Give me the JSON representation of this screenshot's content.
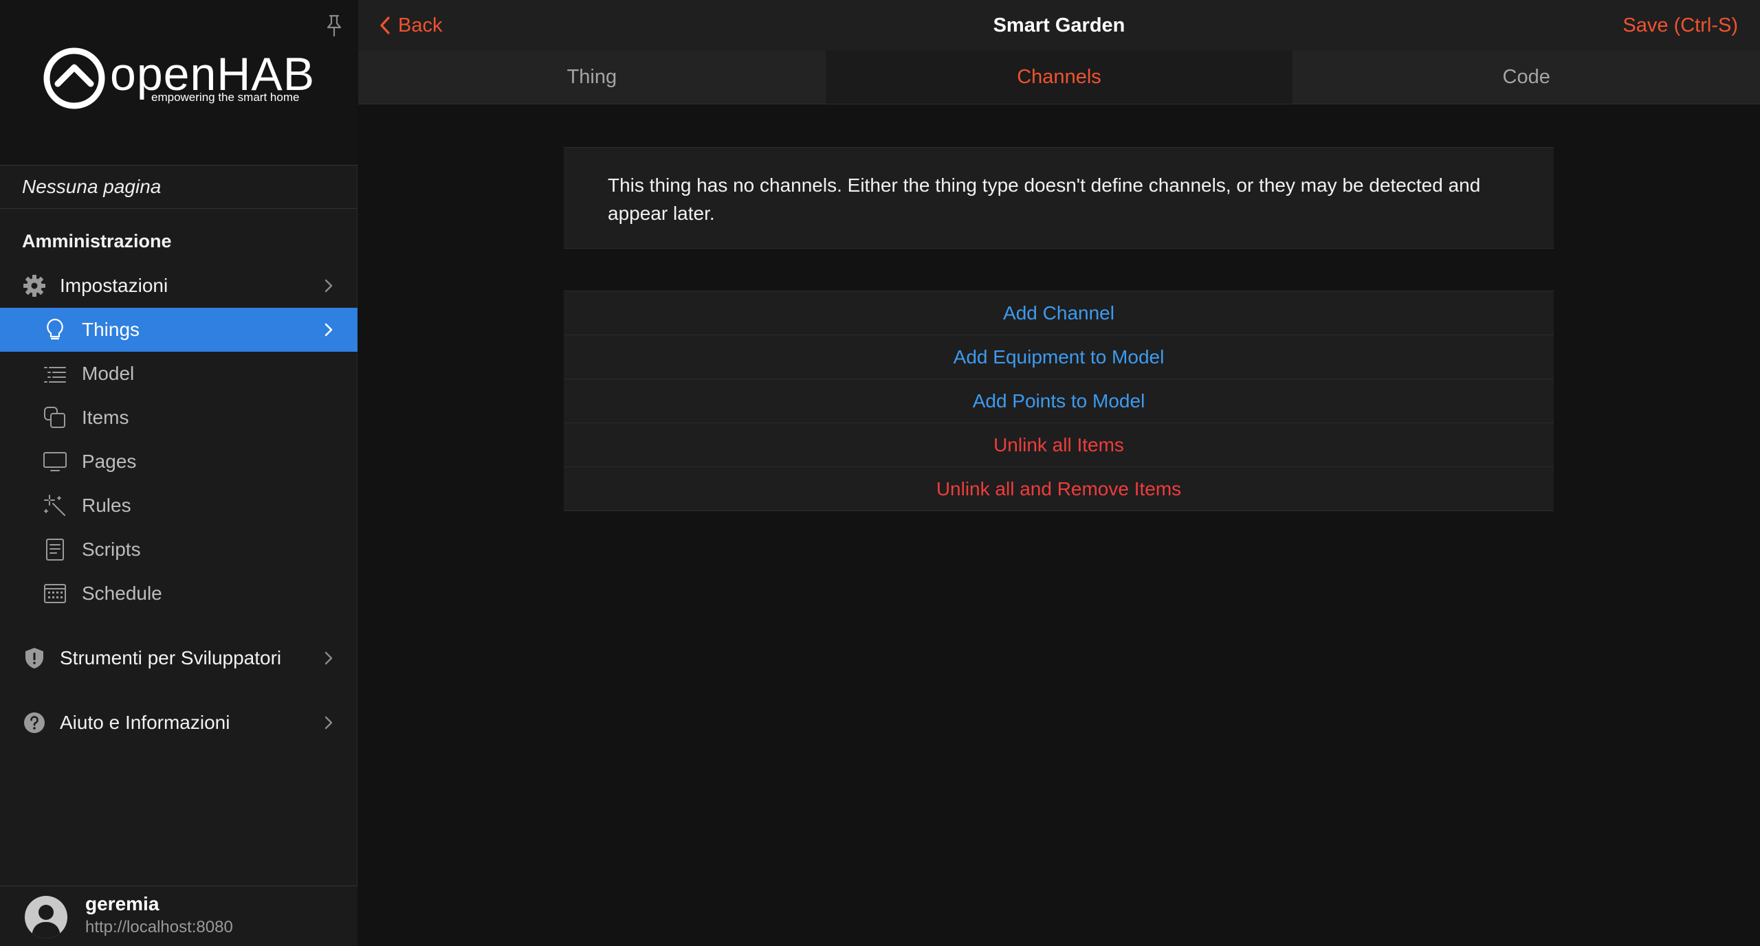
{
  "sidebar": {
    "logo": {
      "title": "openHAB",
      "subtitle": "empowering the smart home"
    },
    "no_page": "Nessuna pagina",
    "section_title": "Amministrazione",
    "settings": {
      "label": "Impostazioni",
      "icon": "gear-icon"
    },
    "items": [
      {
        "label": "Things",
        "icon": "lightbulb-icon",
        "active": true
      },
      {
        "label": "Model",
        "icon": "list-indent-icon"
      },
      {
        "label": "Items",
        "icon": "squares-icon"
      },
      {
        "label": "Pages",
        "icon": "monitor-icon"
      },
      {
        "label": "Rules",
        "icon": "magic-wand-icon"
      },
      {
        "label": "Scripts",
        "icon": "document-icon"
      },
      {
        "label": "Schedule",
        "icon": "calendar-icon"
      }
    ],
    "dev_tools": {
      "label": "Strumenti per Sviluppatori",
      "icon": "shield-icon"
    },
    "help": {
      "label": "Aiuto e Informazioni",
      "icon": "question-icon"
    },
    "user": {
      "name": "geremia",
      "url": "http://localhost:8080"
    }
  },
  "navbar": {
    "back_label": "Back",
    "title": "Smart Garden",
    "save_label": "Save (Ctrl-S)"
  },
  "tabs": [
    {
      "label": "Thing",
      "active": false
    },
    {
      "label": "Channels",
      "active": true
    },
    {
      "label": "Code",
      "active": false
    }
  ],
  "message": "This thing has no channels. Either the thing type doesn't define channels, or they may be detected and appear later.",
  "actions": [
    {
      "label": "Add Channel",
      "color": "blue"
    },
    {
      "label": "Add Equipment to Model",
      "color": "blue"
    },
    {
      "label": "Add Points to Model",
      "color": "blue"
    },
    {
      "label": "Unlink all Items",
      "color": "red"
    },
    {
      "label": "Unlink all and Remove Items",
      "color": "red"
    }
  ],
  "colors": {
    "accent": "#f0532f",
    "active_nav": "#2f80e0",
    "link_blue": "#3d9bf0",
    "danger_red": "#f03c3c"
  }
}
